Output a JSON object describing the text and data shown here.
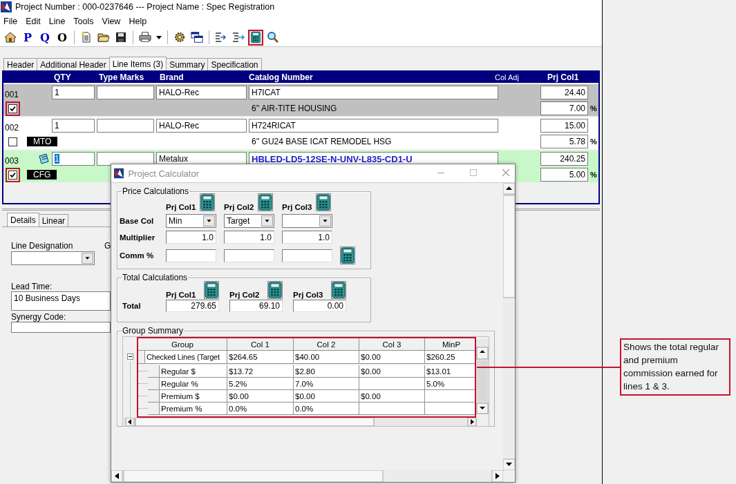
{
  "window": {
    "title": "Project Number : 000-0237646 --- Project Name : Spec Registration"
  },
  "menu": [
    "File",
    "Edit",
    "Line",
    "Tools",
    "View",
    "Help"
  ],
  "toolbar": [
    {
      "kind": "icon",
      "highlighted": false
    },
    {
      "kind": "letter",
      "text": "P",
      "color": "#0000cc",
      "highlighted": false
    },
    {
      "kind": "letter",
      "text": "Q",
      "color": "#0000cc",
      "highlighted": false
    },
    {
      "kind": "letter",
      "text": "O",
      "color": "#000000",
      "highlighted": false
    },
    {
      "kind": "separator"
    },
    {
      "kind": "icon",
      "highlighted": false
    },
    {
      "kind": "icon",
      "highlighted": false
    },
    {
      "kind": "icon",
      "highlighted": false
    },
    {
      "kind": "separator"
    },
    {
      "kind": "icon",
      "highlighted": false
    },
    {
      "kind": "icon",
      "highlighted": false
    },
    {
      "kind": "separator"
    },
    {
      "kind": "icon",
      "highlighted": false
    },
    {
      "kind": "icon",
      "highlighted": false
    },
    {
      "kind": "separator"
    },
    {
      "kind": "icon",
      "highlighted": false
    },
    {
      "kind": "icon",
      "highlighted": false
    },
    {
      "kind": "icon",
      "highlighted": true
    },
    {
      "kind": "icon",
      "highlighted": false
    }
  ],
  "tabs": [
    {
      "label": "Header",
      "selected": false
    },
    {
      "label": "Additional Header",
      "selected": false
    },
    {
      "label": "Line Items (3)",
      "selected": true
    },
    {
      "label": "Summary",
      "selected": false
    },
    {
      "label": "Specification",
      "selected": false
    }
  ],
  "line_grid": {
    "columns": [
      "QTY",
      "Type Marks",
      "Brand",
      "Catalog Number",
      "Col Adj",
      "Prj Col1"
    ],
    "rows": [
      {
        "number": "001",
        "qty": "1",
        "brand": "HALO-Rec",
        "catalog": "H7ICAT",
        "description": "6'' AIR-TITE HOUSING",
        "price": "24.40",
        "percent": "7.00",
        "percent_sign": "%",
        "checked": true,
        "marked": true,
        "selected": true,
        "active": false,
        "has_note": false,
        "focused": false
      },
      {
        "number": "002",
        "qty": "1",
        "brand": "HALO-Rec",
        "catalog": "H724RICAT",
        "description": "6'' GU24 BASE ICAT REMODEL HSG",
        "price": "15.00",
        "percent": "5.78",
        "percent_sign": "%",
        "tag": "MTO",
        "checked": false,
        "marked": false,
        "selected": false,
        "active": false,
        "has_note": false,
        "focused": false
      },
      {
        "number": "003",
        "qty": "1",
        "brand": "Metalux",
        "catalog": "HBLED-LD5-12SE-N-UNV-L835-CD1-U",
        "price": "240.25",
        "percent": "5.00",
        "percent_sign": "%",
        "tag": "CFG",
        "checked": true,
        "marked": true,
        "selected": false,
        "active": true,
        "has_note": true,
        "focused": true
      }
    ]
  },
  "detail_tabs": [
    {
      "label": "Details",
      "selected": true
    },
    {
      "label": "Linear",
      "selected": false
    }
  ],
  "details": {
    "line_designation": "Line Designation",
    "group_label": "G",
    "lead_time_label": "Lead Time:",
    "lead_time": "10 Business Days",
    "synergy_code_label": "Synergy Code:"
  },
  "calculator": {
    "title": "Project Calculator",
    "price": {
      "title": "Price Calculations",
      "row_labels": [
        "Base Col",
        "Multiplier",
        "Comm %"
      ],
      "columns": [
        {
          "header": "Prj Col1",
          "base": "Min",
          "multiplier": "1.0"
        },
        {
          "header": "Prj Col2",
          "base": "Target",
          "multiplier": "1.0"
        },
        {
          "header": "Prj Col3",
          "multiplier": "1.0"
        }
      ]
    },
    "totals": {
      "title": "Total Calculations",
      "label": "Total",
      "columns": [
        {
          "header": "Prj Col1",
          "value": "279.65"
        },
        {
          "header": "Prj Col2",
          "value": "69.10"
        },
        {
          "header": "Prj Col3",
          "value": "0.00"
        }
      ]
    },
    "summary": {
      "title": "Group Summary",
      "highlighted": true,
      "columns": [
        "Group",
        "Col 1",
        "Col 2",
        "Col 3",
        "MinP"
      ],
      "groups": [
        {
          "label": "Checked Lines (Target",
          "expanded": true,
          "col_1": "$264.65",
          "col_2": "$40.00",
          "col_3": "$0.00",
          "minp": "$260.25",
          "children": [
            {
              "label": "Regular $",
              "col_1": "$13.72",
              "col_2": "$2.80",
              "col_3": "$0.00",
              "minp": "$13.01"
            },
            {
              "label": "Regular %",
              "col_1": "5.2%",
              "col_2": "7.0%",
              "minp": "5.0%"
            },
            {
              "label": "Premium $",
              "col_1": "$0.00",
              "col_2": "$0.00",
              "col_3": "$0.00"
            },
            {
              "label": "Premium %",
              "col_1": "0.0%",
              "col_2": "0.0%"
            }
          ]
        }
      ]
    }
  },
  "annotation": {
    "text": "Shows the total regular and premium commission earned for lines 1 & 3."
  }
}
